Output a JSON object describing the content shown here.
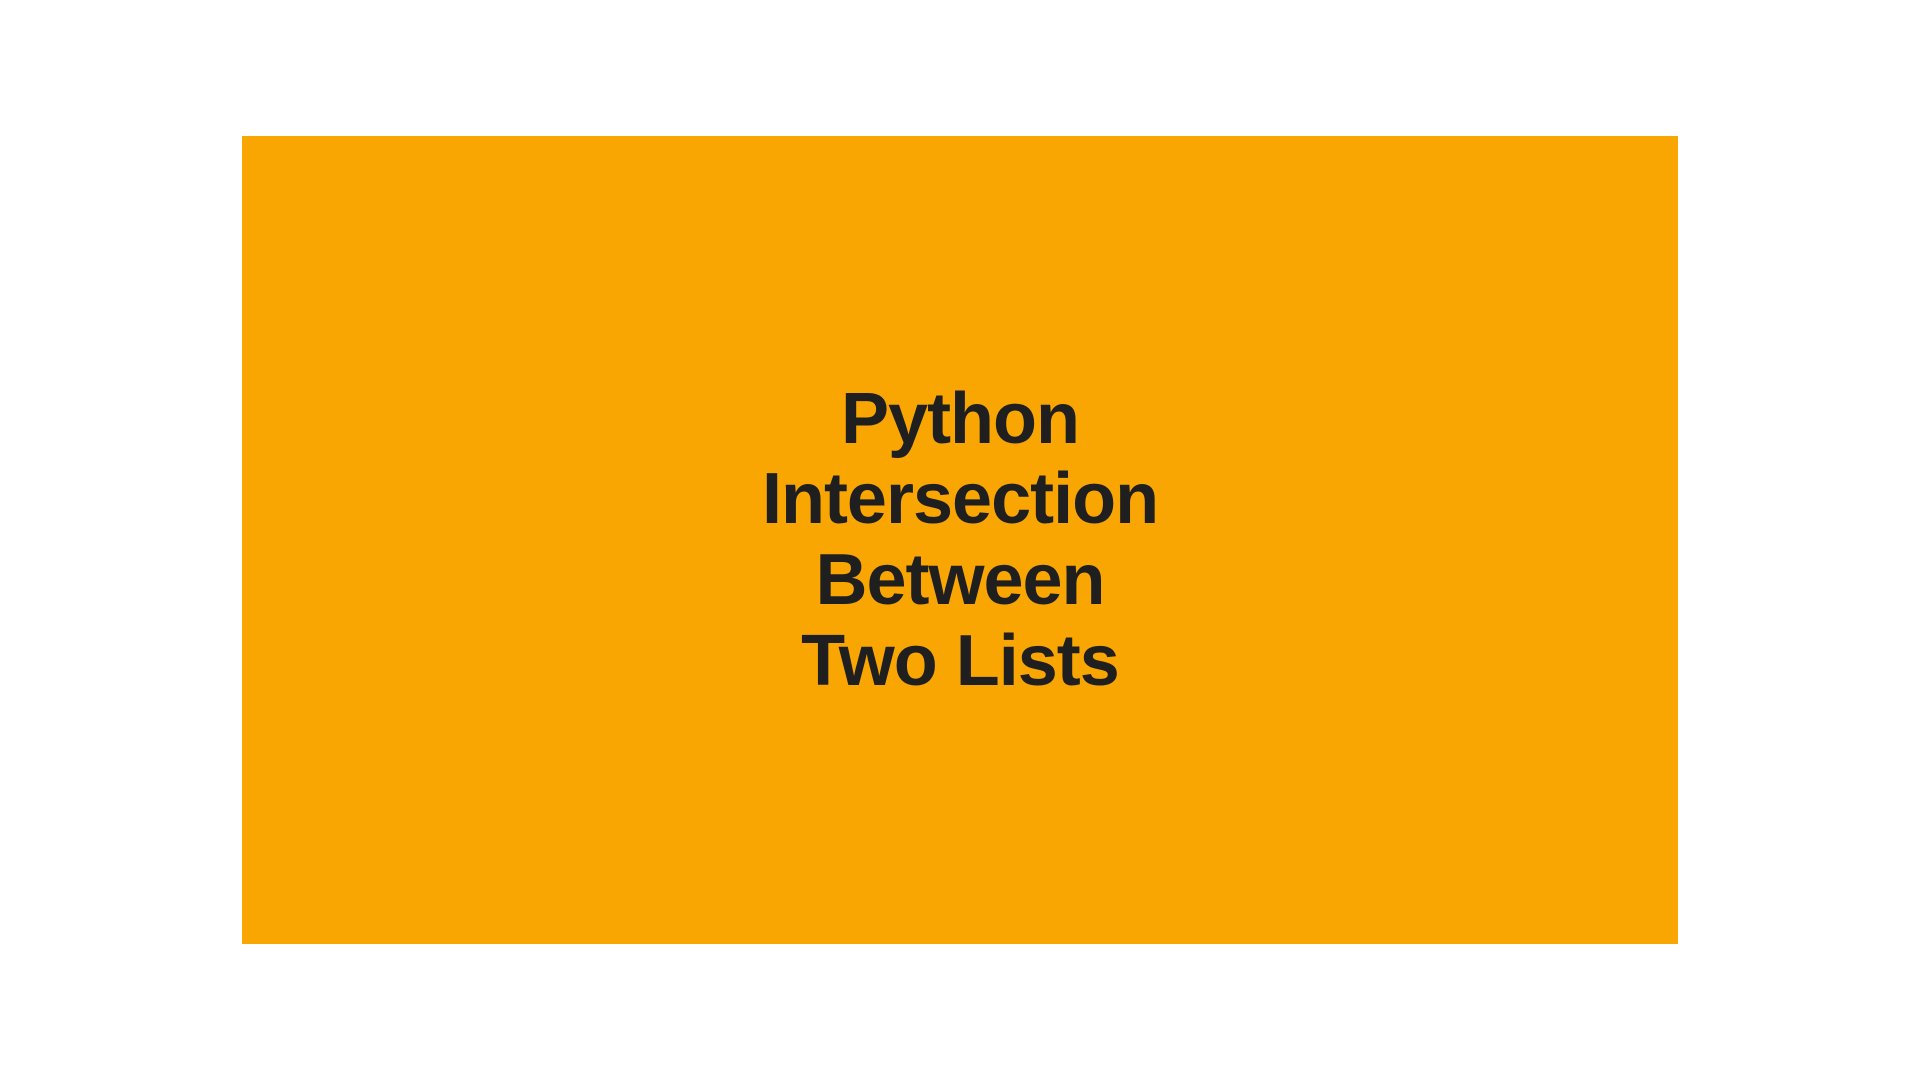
{
  "title": {
    "line1": "Python",
    "line2": "Intersection",
    "line3": "Between",
    "line4": "Two Lists"
  }
}
